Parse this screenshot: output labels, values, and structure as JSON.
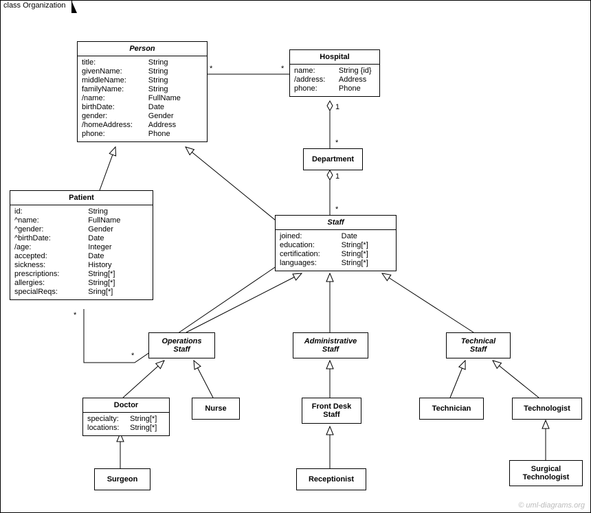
{
  "frame": {
    "label": "class Organization"
  },
  "classes": {
    "person": {
      "name": "Person",
      "attrs": [
        [
          "title:",
          "String"
        ],
        [
          "givenName:",
          "String"
        ],
        [
          "middleName:",
          "String"
        ],
        [
          "familyName:",
          "String"
        ],
        [
          "/name:",
          "FullName"
        ],
        [
          "birthDate:",
          "Date"
        ],
        [
          "gender:",
          "Gender"
        ],
        [
          "/homeAddress:",
          "Address"
        ],
        [
          "phone:",
          "Phone"
        ]
      ]
    },
    "hospital": {
      "name": "Hospital",
      "attrs": [
        [
          "name:",
          "String {id}"
        ],
        [
          "/address:",
          "Address"
        ],
        [
          "phone:",
          "Phone"
        ]
      ]
    },
    "department": {
      "name": "Department"
    },
    "patient": {
      "name": "Patient",
      "attrs": [
        [
          "id:",
          "String"
        ],
        [
          "^name:",
          "FullName"
        ],
        [
          "^gender:",
          "Gender"
        ],
        [
          "^birthDate:",
          "Date"
        ],
        [
          "/age:",
          "Integer"
        ],
        [
          "accepted:",
          "Date"
        ],
        [
          "sickness:",
          "History"
        ],
        [
          "prescriptions:",
          "String[*]"
        ],
        [
          "allergies:",
          "String[*]"
        ],
        [
          "specialReqs:",
          "Sring[*]"
        ]
      ]
    },
    "staff": {
      "name": "Staff",
      "attrs": [
        [
          "joined:",
          "Date"
        ],
        [
          "education:",
          "String[*]"
        ],
        [
          "certification:",
          "String[*]"
        ],
        [
          "languages:",
          "String[*]"
        ]
      ]
    },
    "operationsStaff": {
      "name1": "Operations",
      "name2": "Staff"
    },
    "administrativeStaff": {
      "name1": "Administrative",
      "name2": "Staff"
    },
    "technicalStaff": {
      "name1": "Technical",
      "name2": "Staff"
    },
    "doctor": {
      "name": "Doctor",
      "attrs": [
        [
          "specialty:",
          "String[*]"
        ],
        [
          "locations:",
          "String[*]"
        ]
      ]
    },
    "nurse": {
      "name": "Nurse"
    },
    "frontDeskStaff": {
      "name1": "Front Desk",
      "name2": "Staff"
    },
    "technician": {
      "name": "Technician"
    },
    "technologist": {
      "name": "Technologist"
    },
    "surgeon": {
      "name": "Surgeon"
    },
    "receptionist": {
      "name": "Receptionist"
    },
    "surgicalTechnologist": {
      "name1": "Surgical",
      "name2": "Technologist"
    }
  },
  "mult": {
    "personHospital_l": "*",
    "personHospital_r": "*",
    "hospitalDept": "1",
    "deptTop": "*",
    "deptStaff": "1",
    "staffTop": "*",
    "patientStaff_l": "*",
    "patientStaff_r": "*"
  },
  "watermark": "© uml-diagrams.org"
}
